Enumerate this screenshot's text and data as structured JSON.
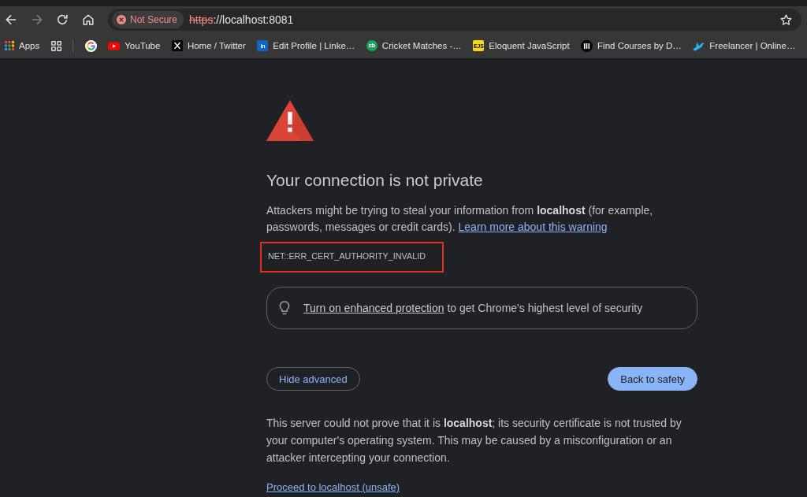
{
  "toolbar": {
    "nav_buttons": [
      {
        "kind": "back",
        "disabled": false
      },
      {
        "kind": "forward",
        "disabled": true
      },
      {
        "kind": "reload",
        "disabled": false
      },
      {
        "kind": "home",
        "disabled": false
      }
    ],
    "omnibox": {
      "secure": false,
      "security_chip": "Not Secure",
      "scheme": "https",
      "rest_of_url": "://localhost:8081"
    }
  },
  "bookmarks_bar": {
    "apps_label": "Apps",
    "bookmarks": [
      {
        "kind": "g_logo"
      },
      {
        "kind": "play",
        "label": "YouTube"
      },
      {
        "kind": "x_logo",
        "label": "Home / Twitter"
      },
      {
        "kind": "letter_tile",
        "favicon_text": "in",
        "color": "#0a66c2",
        "label": "Edit Profile | Linke…"
      },
      {
        "kind": "letter_circle",
        "favicon_text": "cb",
        "color": "#1ca35d",
        "label": "Cricket Matches -…"
      },
      {
        "kind": "letter_tile",
        "favicon_text": "EJS",
        "color": "#f7d81e",
        "label": "Eloquent JavaScript"
      },
      {
        "kind": "bars_circle",
        "label": "Find Courses by D…"
      },
      {
        "kind": "bird",
        "label": "Freelancer | Online…"
      }
    ]
  },
  "interstitial": {
    "heading": "Your connection is not private",
    "intro": {
      "text": "Attackers might be trying to steal your information from **localhost** (for example, passwords, messages or credit cards).",
      "link": "Learn more about this warning"
    },
    "error_code": {
      "text": "NET::ERR_CERT_AUTHORITY_INVALID",
      "highlighted": true
    },
    "tip": {
      "link": "Turn on enhanced protection",
      "text": "to get Chrome's highest level of security"
    },
    "buttons": [
      {
        "kind": "secondary",
        "label": "Hide advanced"
      },
      {
        "kind": "primary",
        "label": "Back to safety"
      }
    ],
    "details": "This server could not prove that it is **localhost**; its security certificate is not trusted by your computer's operating system. This may be caused by a misconfiguration or an attacker intercepting your connection.",
    "proceed_link": "Proceed to localhost (unsafe)"
  }
}
